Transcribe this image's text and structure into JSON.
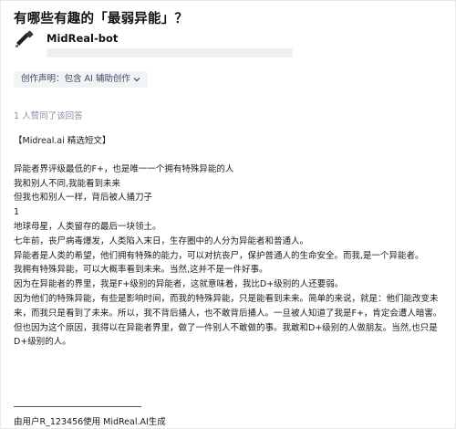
{
  "question": {
    "title": "有哪些有趣的「最弱异能」？"
  },
  "author": {
    "name": "MidReal-bot",
    "avatar_icon": "midreal-logo-icon"
  },
  "declaration": {
    "label": "创作声明：包含 AI 辅助创作"
  },
  "meta": {
    "upvotes": "1 人赞同了该回答"
  },
  "answer": {
    "tag": "【Midreal.ai 精选短文】",
    "paragraphs": [
      "异能者界评级最低的F+，也是唯一一个拥有特殊异能的人",
      "我和别人不同,我能看到未来",
      "但我也和别人一样，背后被人捅刀子",
      "1",
      "地球母星，人类留存的最后一块领土。",
      "七年前，丧尸病毒爆发，人类陷入末日，生存圈中的人分为异能者和普通人。",
      "异能者是人类的希望，他们拥有特殊的能力，可以对抗丧尸，保护普通人的生命安全。而我,是一个异能者。",
      "我拥有特殊异能，可以大概率看到未来。当然,这并不是一件好事。",
      "因为在异能者的界里，我是F+级别的异能者，这就意味着，我比D+级别的人还要弱。",
      "因为他们的特殊异能，有些是影响时间，而我的特殊异能，只是能看到未来。简单的来说，就是：他们能改变未来，而我只是看到了未来。所以，我不背后捅人，也不敢背后捅人。一旦被人知道了我是F+，肯定会遭人暗害。",
      "但也因为这个原因，我得以在异能者界里，做了一件别人不敢做的事。我敢和D+级别的人做朋友。当然,也只是D+级别的人。"
    ]
  },
  "footer": {
    "note": "由用户R_123456使用 MidReal.AI生成"
  },
  "colors": {
    "tag_bg": "#f2f3f5",
    "tag_text": "#3d4a66",
    "meta_text": "#8590a6"
  }
}
